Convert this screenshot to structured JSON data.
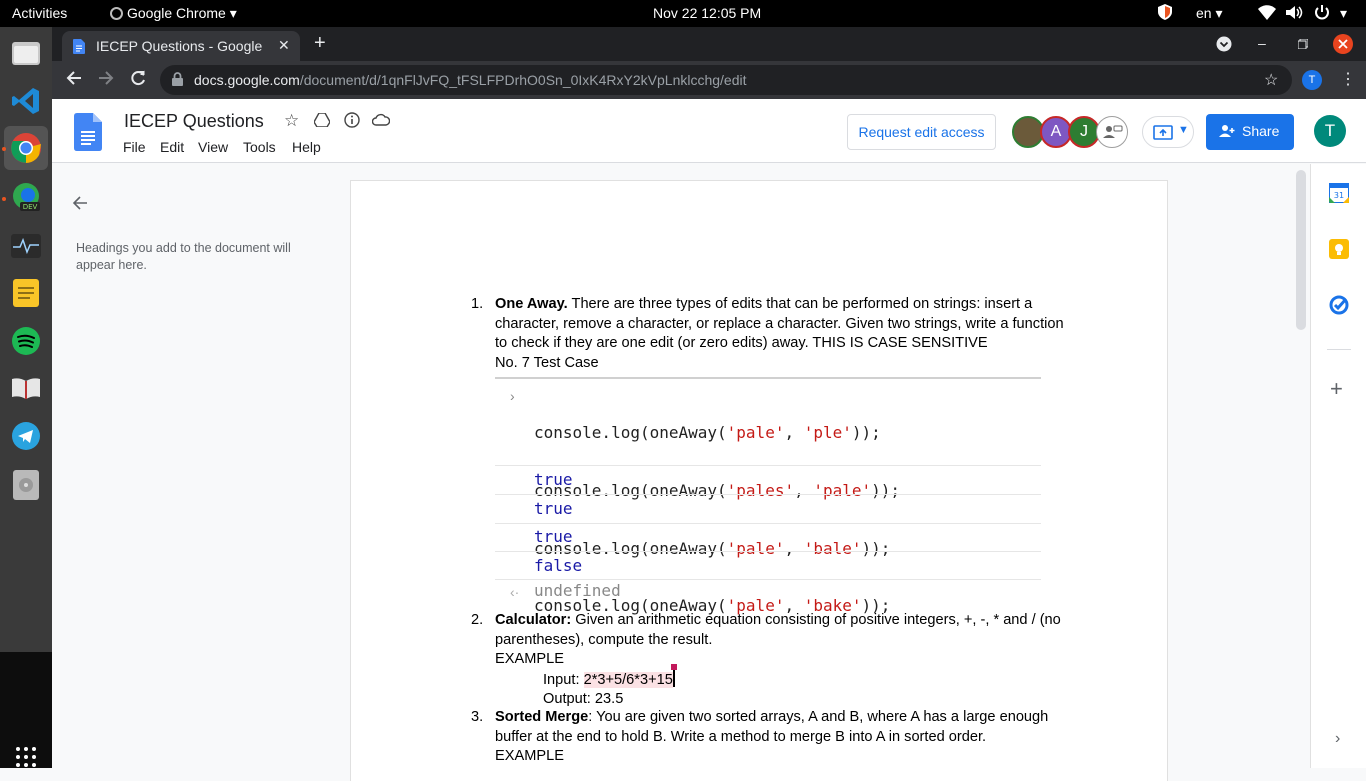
{
  "system": {
    "activities": "Activities",
    "app_name": "Google Chrome",
    "datetime": "Nov 22  12:05 PM",
    "lang": "en"
  },
  "chrome": {
    "tab_title": "IECEP Questions - Google",
    "url_host": "docs.google.com",
    "url_path": "/document/d/1qnFlJvFQ_tFSLFPDrhO0Sn_0IxK4RxY2kVpLnklcchg/edit",
    "profile_initial": "T"
  },
  "docs": {
    "title": "IECEP Questions",
    "menu": [
      "File",
      "Edit",
      "View",
      "Tools",
      "Help"
    ],
    "request_edit": "Request edit access",
    "share": "Share",
    "avatars": [
      "A",
      "J"
    ],
    "user_initial": "T"
  },
  "outline": {
    "empty_text": "Headings you add to the document will appear here."
  },
  "content": {
    "q1_num": "1.",
    "q1_bold": "One Away.",
    "q1_line1": " There are three types of edits that can be performed on strings: insert a",
    "q1_line2": "character, remove a character, or replace a character. Given two strings, write a function",
    "q1_line3": "to check if they are one edit (or zero edits) away. THIS IS CASE SENSITIVE",
    "q1_line4": "No. 7 Test Case",
    "code_lines": [
      {
        "pre": "console.log(oneAway(",
        "a": "'pale'",
        "sep": ", ",
        "b": "'ple'",
        "post": "));"
      },
      {
        "pre": "console.log(oneAway(",
        "a": "'pales'",
        "sep": ", ",
        "b": "'pale'",
        "post": "));"
      },
      {
        "pre": "console.log(oneAway(",
        "a": "'pale'",
        "sep": ", ",
        "b": "'bale'",
        "post": "));"
      },
      {
        "pre": "console.log(oneAway(",
        "a": "'pale'",
        "sep": ", ",
        "b": "'bake'",
        "post": "));"
      }
    ],
    "results": [
      "true",
      "true",
      "true",
      "false"
    ],
    "undefined": "undefined",
    "q2_num": "2.",
    "q2_bold": "Calculator:",
    "q2_line1": " Given an arithmetic equation consisting of positive integers, +, -, * and / (no",
    "q2_line2": "parentheses), compute the result.",
    "q2_example": "EXAMPLE",
    "q2_input_label": "Input: ",
    "q2_input_value": "2*3+5/6*3+15",
    "q2_output": "Output: 23.5",
    "q3_num": "3.",
    "q3_bold": "Sorted Merge",
    "q3_line1": ": You are given two sorted arrays, A and B, where A has a large enough",
    "q3_line2": "buffer at the end to hold B. Write a method to merge B into A in sorted order.",
    "q3_example": "EXAMPLE"
  }
}
